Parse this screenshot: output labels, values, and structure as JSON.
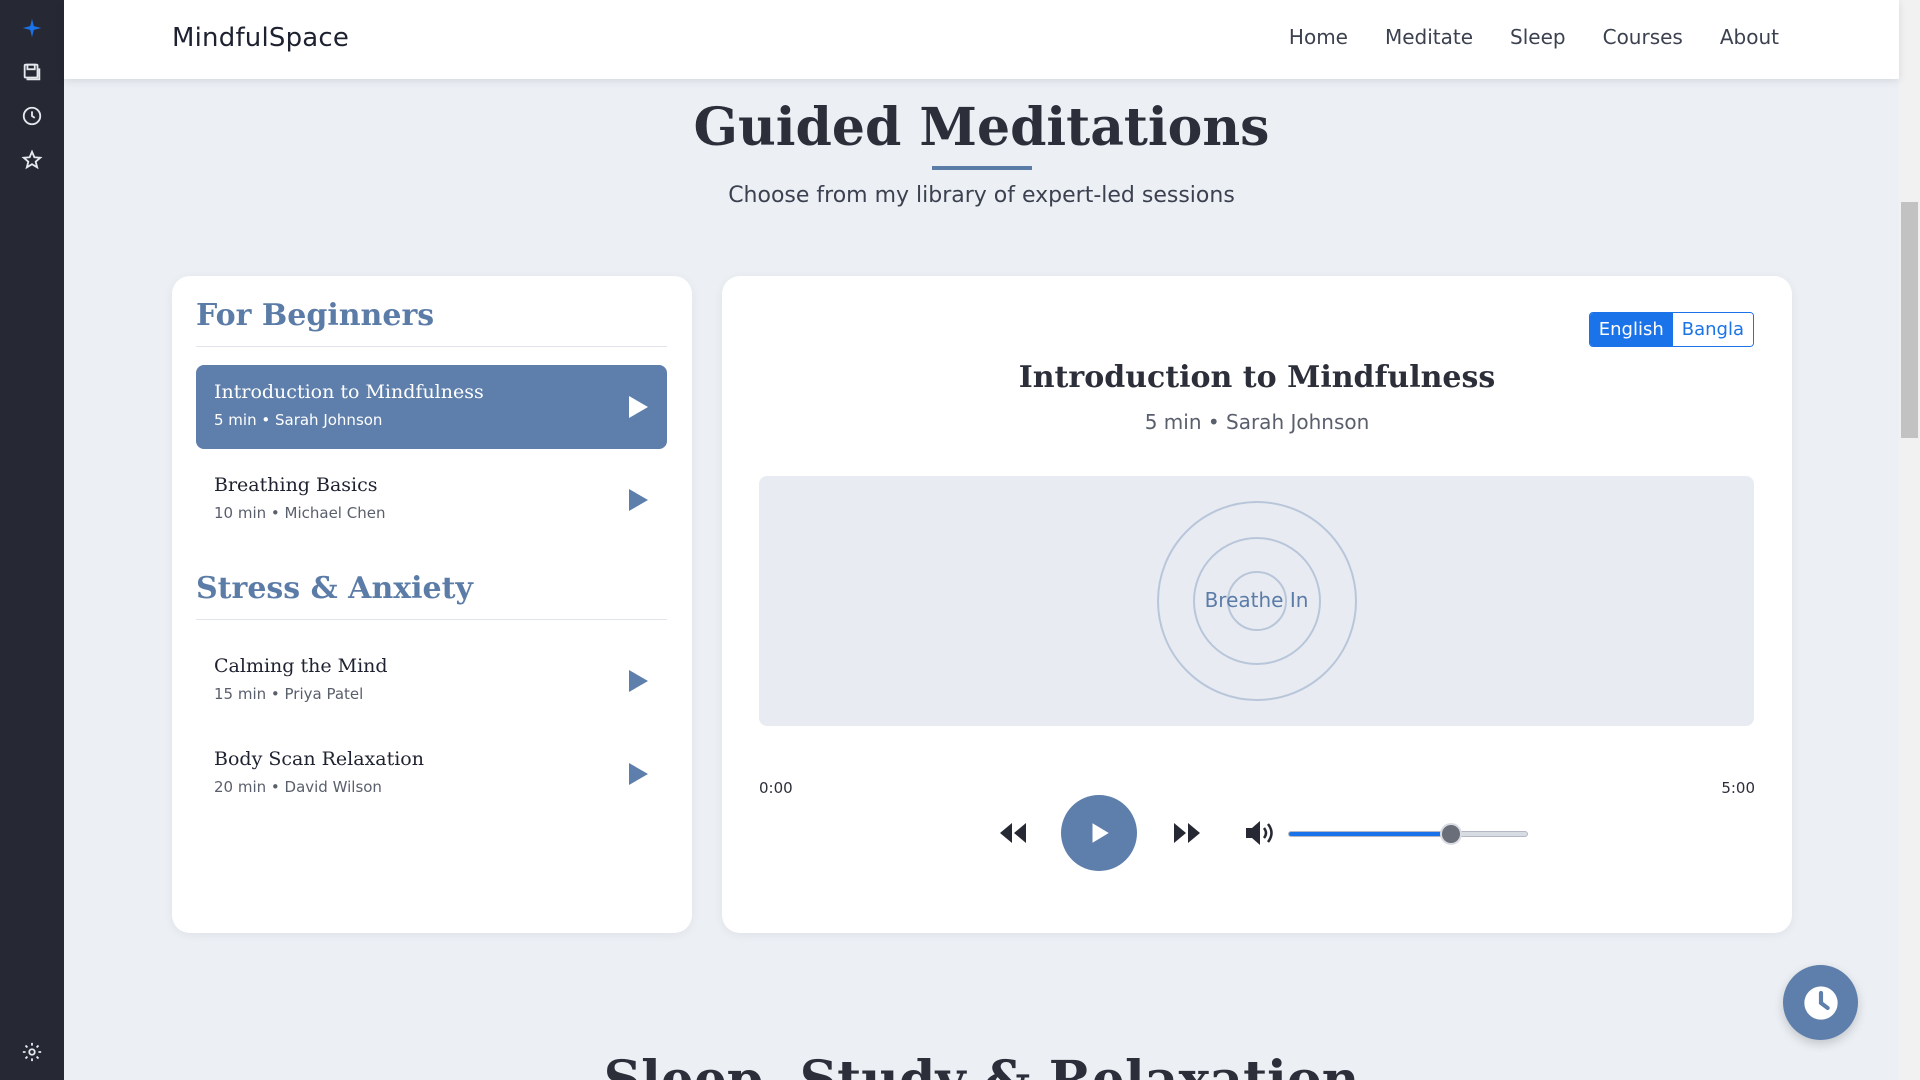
{
  "sidebar": {
    "icons": [
      "sparkle-icon",
      "save-icon",
      "history-icon",
      "star-icon",
      "settings-icon"
    ],
    "accent": "#1a73e8"
  },
  "header": {
    "brand": "MindfulSpace",
    "nav": [
      "Home",
      "Meditate",
      "Sleep",
      "Courses",
      "About"
    ]
  },
  "hero": {
    "title": "Guided Meditations",
    "subtitle": "Choose from my library of expert-led sessions"
  },
  "categories": [
    {
      "title": "For Beginners",
      "items": [
        {
          "title": "Introduction to Mindfulness",
          "meta": "5 min • Sarah Johnson",
          "active": true
        },
        {
          "title": "Breathing Basics",
          "meta": "10 min • Michael Chen",
          "active": false
        }
      ]
    },
    {
      "title": "Stress & Anxiety",
      "items": [
        {
          "title": "Calming the Mind",
          "meta": "15 min • Priya Patel",
          "active": false
        },
        {
          "title": "Body Scan Relaxation",
          "meta": "20 min • David Wilson",
          "active": false
        }
      ]
    }
  ],
  "player": {
    "languages": {
      "english": "English",
      "bangla": "Bangla"
    },
    "selected_language": "English",
    "title": "Introduction to Mindfulness",
    "meta": "5 min • Sarah Johnson",
    "breath_text": "Breathe In",
    "current_time": "0:00",
    "total_time": "5:00",
    "volume_level": 0.68
  },
  "next_section": {
    "title": "Sleep, Study & Relaxation"
  },
  "colors": {
    "primary": "#5e7fab",
    "background": "#ecf0f5",
    "link_blue": "#1a73e8"
  }
}
